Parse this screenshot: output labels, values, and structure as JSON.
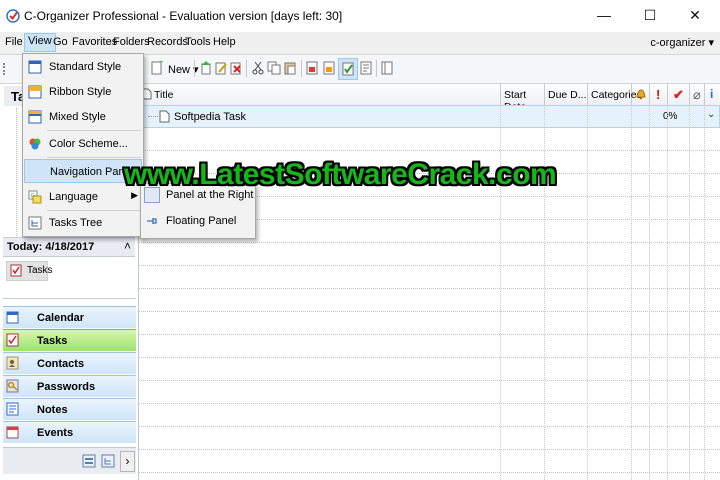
{
  "window": {
    "title": "C-Organizer Professional - Evaluation version [days left: 30]",
    "minimize": "—",
    "maximize": "☐",
    "close": "✕"
  },
  "menubar": {
    "items": [
      "File",
      "View",
      "Go",
      "Favorites",
      "Folders",
      "Records",
      "Tools",
      "Help"
    ],
    "profile": "c-organizer ▾"
  },
  "toolbar": {
    "new_label": "New ▾"
  },
  "view_menu": {
    "items": [
      {
        "label": "Standard Style",
        "icon": "standard-style-icon"
      },
      {
        "label": "Ribbon Style",
        "icon": "ribbon-style-icon"
      },
      {
        "label": "Mixed Style",
        "icon": "mixed-style-icon"
      },
      {
        "label": "Color Scheme...",
        "icon": "color-scheme-icon"
      },
      {
        "label": "Navigation Panel",
        "icon": "navigation-panel-icon"
      },
      {
        "label": "Language",
        "icon": "language-icon"
      },
      {
        "label": "Tasks Tree",
        "icon": "tasks-tree-icon"
      }
    ],
    "submenu": [
      "Panel at the Right",
      "Floating Panel"
    ]
  },
  "left_panel": {
    "header_fragment": "Tas",
    "today_label": "Today: 4/18/2017",
    "today_item": "Tasks",
    "nav": [
      "Calendar",
      "Tasks",
      "Contacts",
      "Passwords",
      "Notes",
      "Events"
    ]
  },
  "grid": {
    "columns": [
      "Title",
      "Start Date",
      "Due D...",
      "Categories"
    ],
    "rows": [
      {
        "title": "Softpedia Task",
        "progress": "0%"
      }
    ]
  },
  "watermark": "www.LatestSoftwareCrack.com",
  "colors": {
    "accent": "#cce4f7",
    "selected_nav": "#9be36a",
    "nav": "#cfe5f7",
    "watermark": "#17b41c"
  }
}
